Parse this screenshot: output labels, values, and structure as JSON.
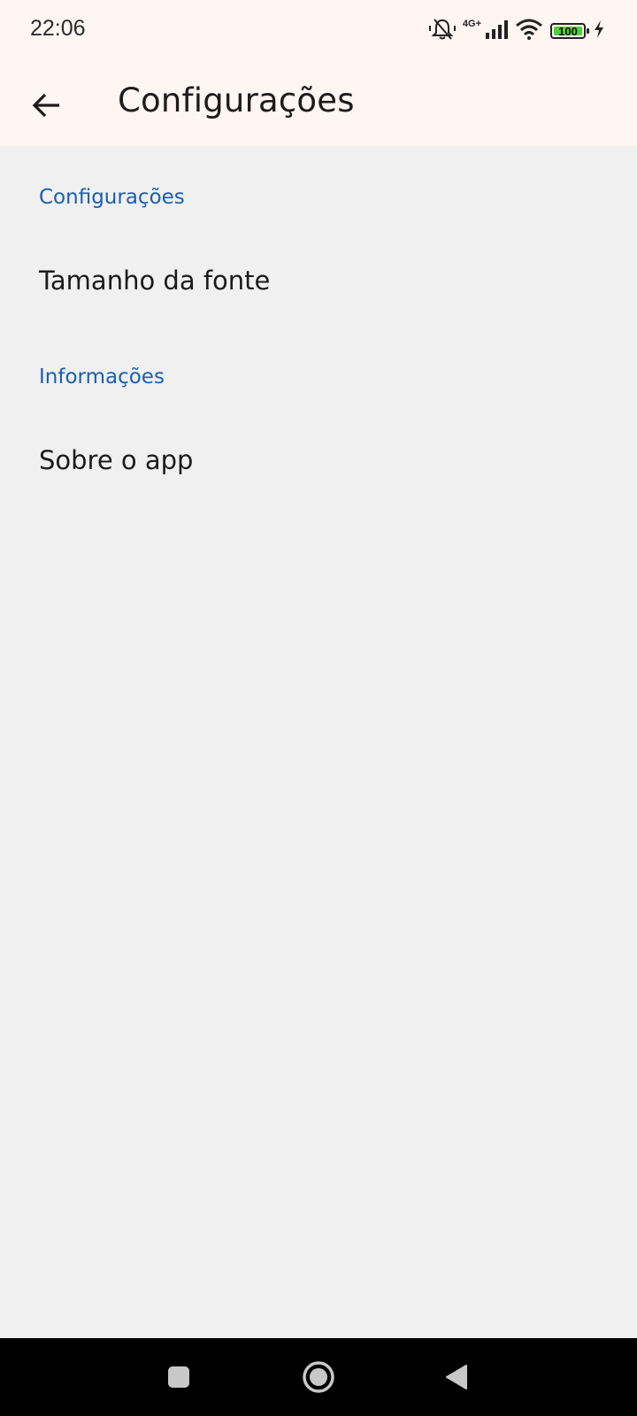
{
  "status_bar": {
    "time": "22:06",
    "network_label": "4G+",
    "battery_level": "100",
    "icons": [
      "mute-bell-icon",
      "signal-icon",
      "wifi-icon",
      "battery-icon",
      "charging-icon"
    ]
  },
  "app_bar": {
    "title": "Configurações",
    "back_icon": "arrow-back-icon"
  },
  "sections": [
    {
      "header": "Configurações",
      "items": [
        {
          "label": "Tamanho da fonte"
        }
      ]
    },
    {
      "header": "Informações",
      "items": [
        {
          "label": "Sobre o app"
        }
      ]
    }
  ],
  "nav_bar": {
    "buttons": [
      "recents-square-icon",
      "home-circle-icon",
      "back-triangle-icon"
    ]
  },
  "colors": {
    "accent": "#1b5fb0",
    "bar_background": "#fff5f2",
    "page_background": "#f0f0f0",
    "battery_fill": "#4cd137"
  }
}
